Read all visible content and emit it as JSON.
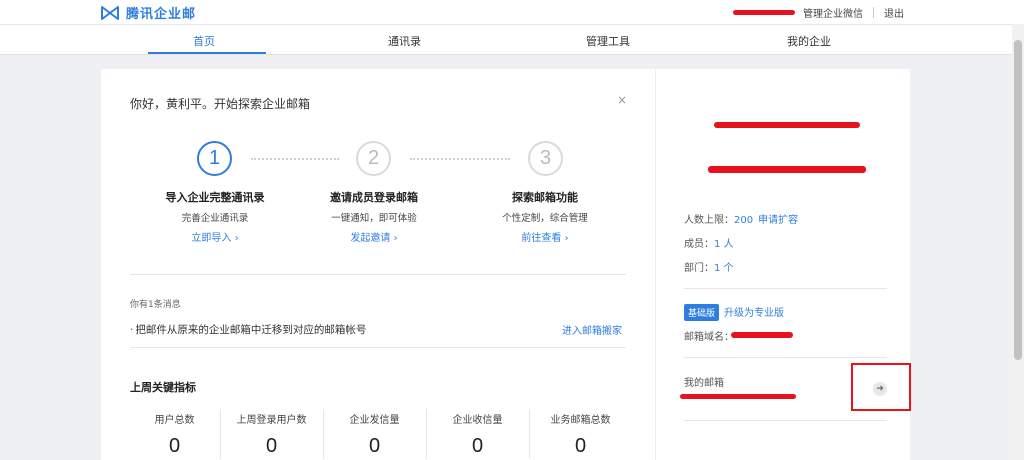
{
  "brand": {
    "name": "腾讯企业邮"
  },
  "topbar": {
    "manage_wechat": "管理企业微信",
    "logout": "退出"
  },
  "nav": [
    {
      "label": "首页",
      "active": true
    },
    {
      "label": "通讯录",
      "active": false
    },
    {
      "label": "管理工具",
      "active": false
    },
    {
      "label": "我的企业",
      "active": false
    }
  ],
  "welcome": {
    "greeting": "你好，黄利平。开始探索企业邮箱",
    "close": "×"
  },
  "steps": [
    {
      "number": "1",
      "title": "导入企业完整通讯录",
      "desc": "完善企业通讯录",
      "link": "立即导入 ›"
    },
    {
      "number": "2",
      "title": "邀请成员登录邮箱",
      "desc": "一键通知，即可体验",
      "link": "发起邀请 ›"
    },
    {
      "number": "3",
      "title": "探索邮箱功能",
      "desc": "个性定制，综合管理",
      "link": "前往查看 ›"
    }
  ],
  "messages": {
    "count_text": "你有1条消息",
    "bullet": "·",
    "item_text": "把邮件从原来的企业邮箱中迁移到对应的邮箱帐号",
    "action_link": "进入邮箱搬家"
  },
  "kpi": {
    "title": "上周关键指标",
    "items": [
      {
        "label": "用户总数",
        "value": "0"
      },
      {
        "label": "上周登录用户数",
        "value": "0"
      },
      {
        "label": "企业发信量",
        "value": "0"
      },
      {
        "label": "企业收信量",
        "value": "0"
      },
      {
        "label": "业务邮箱总数",
        "value": "0"
      }
    ]
  },
  "sidebar": {
    "user_limit_label": "人数上限：",
    "user_limit_value": "200",
    "expand_link": "申请扩容",
    "members_label": "成员：",
    "members_value": "1 人",
    "departments_label": "部门：",
    "departments_value": "1 个",
    "edition_badge": "基础版",
    "upgrade_link": "升级为专业版",
    "domain_label": "邮箱域名：",
    "my_mailbox_label": "我的邮箱",
    "arrow_icon": "arrow-right-icon"
  },
  "colors": {
    "accent": "#2f7de1",
    "redaction": "#e8121d"
  }
}
